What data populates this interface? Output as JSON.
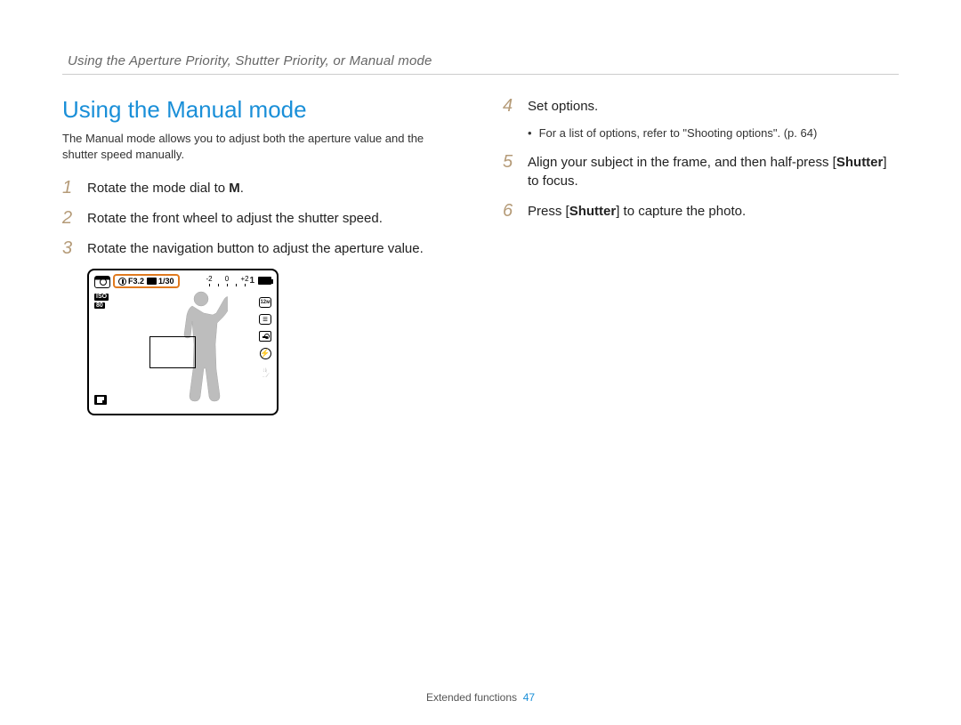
{
  "breadcrumb": "Using the Aperture Priority, Shutter Priority, or Manual mode",
  "section_title": "Using the Manual mode",
  "intro": "The Manual mode allows you to adjust both the aperture value and the shutter speed manually.",
  "left_steps": {
    "s1": {
      "num": "1",
      "pre": "Rotate the mode dial to ",
      "mode": "M",
      "post": "."
    },
    "s2": {
      "num": "2",
      "text": "Rotate the front wheel to adjust the shutter speed."
    },
    "s3": {
      "num": "3",
      "text": "Rotate the navigation button to adjust the aperture value."
    }
  },
  "right_steps": {
    "s4": {
      "num": "4",
      "text": "Set options."
    },
    "s4_bullet": "For a list of options, refer to \"Shooting options\". (p. 64)",
    "s5": {
      "num": "5",
      "pre": "Align your subject in the frame, and then half-press [",
      "bold": "Shutter",
      "post": "] to focus."
    },
    "s6": {
      "num": "6",
      "pre": "Press [",
      "bold": "Shutter",
      "post": "] to capture the photo."
    }
  },
  "lcd": {
    "aperture": "F3.2",
    "shutter": "1/30",
    "ev_labels": [
      "-2",
      "",
      "0",
      "",
      "+2"
    ],
    "shots_remaining": "1",
    "iso_label": "ISO",
    "iso_value": "80",
    "size_label": "12м"
  },
  "footer": {
    "section": "Extended functions",
    "page": "47"
  }
}
